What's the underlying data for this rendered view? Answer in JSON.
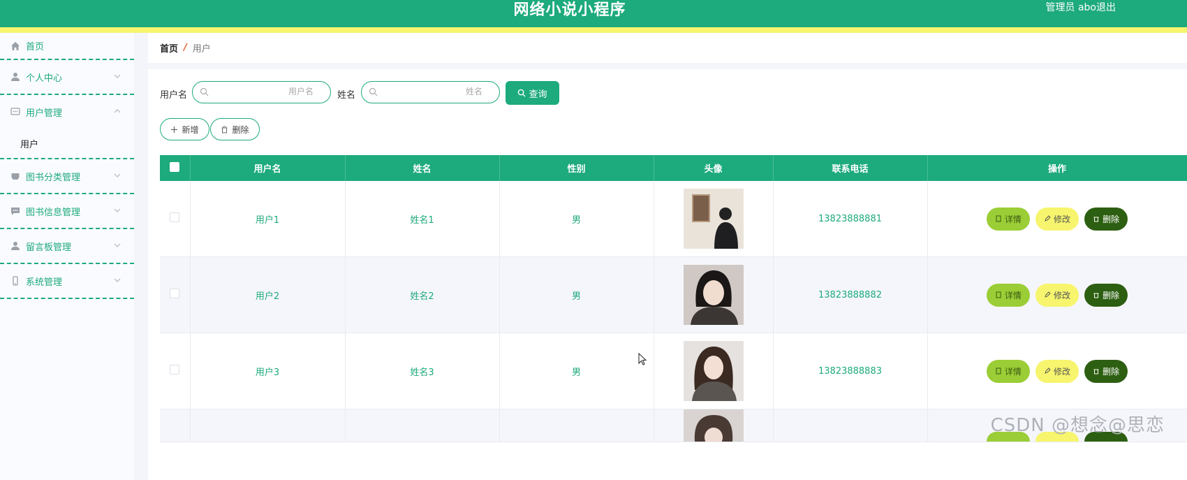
{
  "header": {
    "title": "网络小说小程序",
    "user_label": "管理员 abo",
    "logout_label": "退出",
    "colors": {
      "brand": "#1daa7c",
      "accent_strip": "#f6f56d"
    }
  },
  "sidebar": {
    "items": [
      {
        "label": "首页",
        "icon": "home-icon"
      },
      {
        "label": "个人中心",
        "icon": "person-icon",
        "expanded": false
      },
      {
        "label": "用户管理",
        "icon": "chat-icon",
        "expanded": true,
        "children": [
          {
            "label": "用户"
          }
        ]
      },
      {
        "label": "图书分类管理",
        "icon": "book-icon",
        "expanded": false
      },
      {
        "label": "图书信息管理",
        "icon": "message-icon",
        "expanded": false
      },
      {
        "label": "留言板管理",
        "icon": "person-icon",
        "expanded": false
      },
      {
        "label": "系统管理",
        "icon": "phone-icon",
        "expanded": false
      }
    ]
  },
  "breadcrumb": {
    "home": "首页",
    "separator": "/",
    "current": "用户"
  },
  "search": {
    "username_label": "用户名",
    "username_placeholder": "用户名",
    "name_label": "姓名",
    "name_placeholder": "姓名",
    "query_label": "查询"
  },
  "toolbar": {
    "add_label": "新增",
    "delete_label": "删除"
  },
  "table": {
    "columns": [
      "用户名",
      "姓名",
      "性别",
      "头像",
      "联系电话",
      "操作"
    ],
    "rows": [
      {
        "username": "用户1",
        "name": "姓名1",
        "gender": "男",
        "phone": "13823888881"
      },
      {
        "username": "用户2",
        "name": "姓名2",
        "gender": "男",
        "phone": "13823888882"
      },
      {
        "username": "用户3",
        "name": "姓名3",
        "gender": "男",
        "phone": "13823888883"
      }
    ],
    "actions": {
      "detail": "详情",
      "edit": "修改",
      "delete": "删除"
    }
  },
  "watermark": "CSDN @想念@思恋"
}
